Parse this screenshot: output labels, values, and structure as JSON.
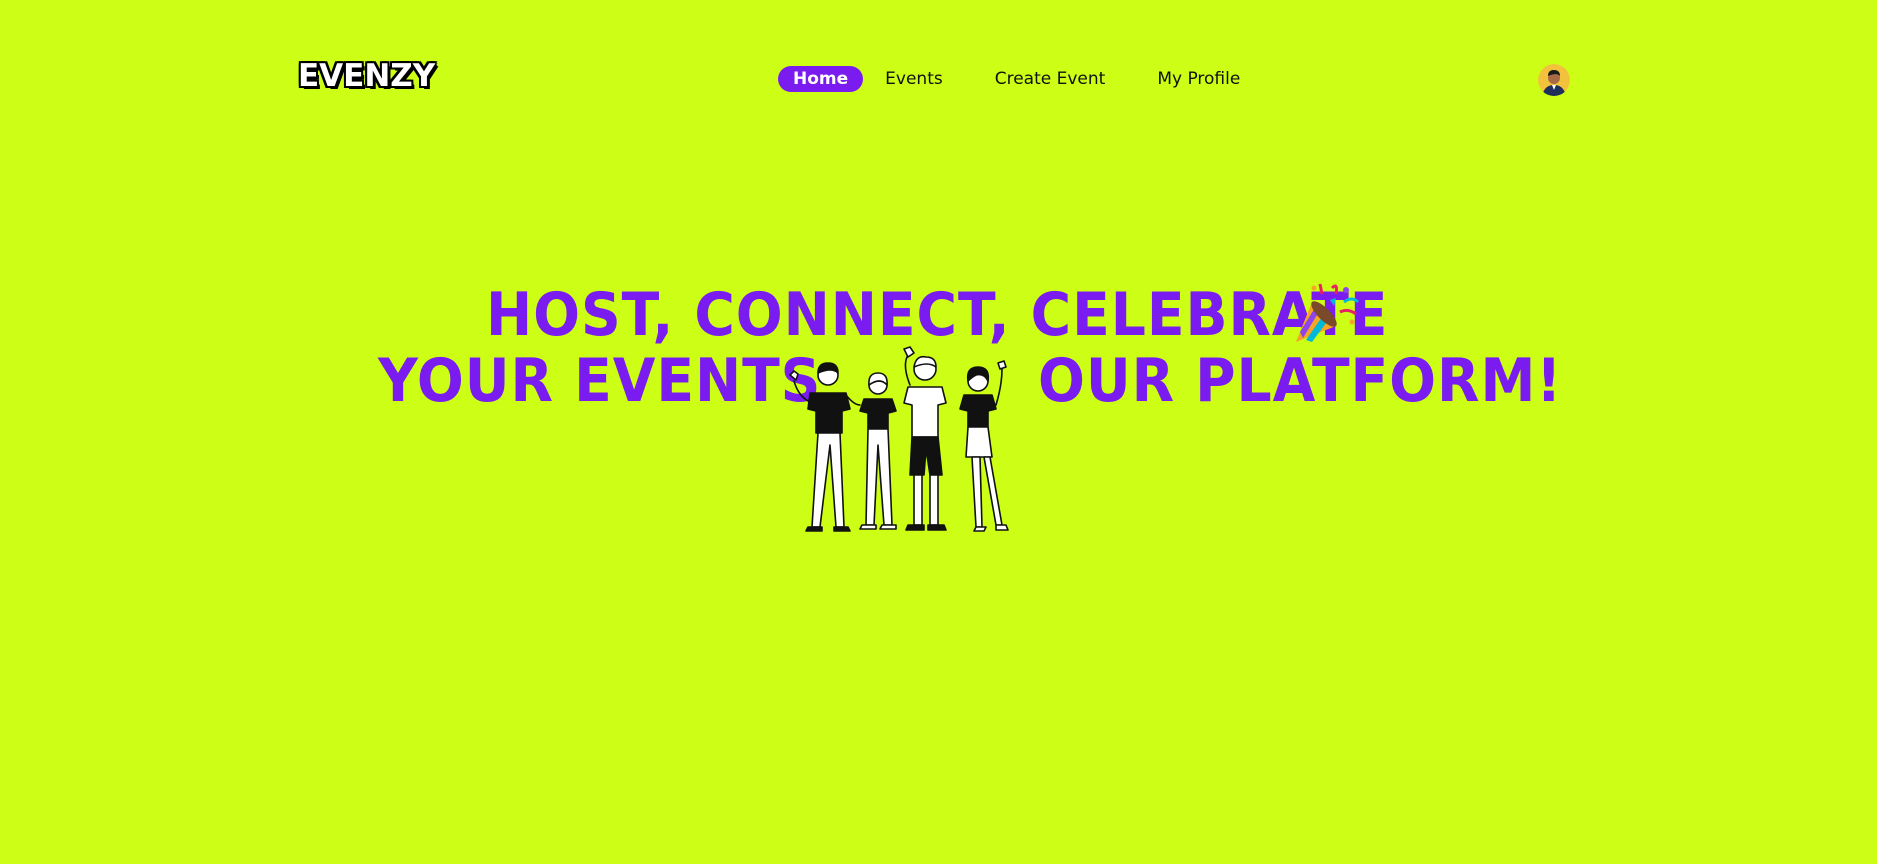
{
  "colors": {
    "background": "#ccff15",
    "accent": "#7a1cf0",
    "text": "#111111",
    "logo_fill": "#ffffff",
    "logo_stroke": "#000000"
  },
  "header": {
    "logo": "EVENZY",
    "nav": [
      {
        "label": "Home",
        "active": true
      },
      {
        "label": "Events",
        "active": false
      },
      {
        "label": "Create Event",
        "active": false
      },
      {
        "label": "My Profile",
        "active": false
      }
    ],
    "avatar_icon": "user-avatar-icon"
  },
  "hero": {
    "line1": "HOST, CONNECT, CELEBRATE",
    "line2_left": "YOUR EVENTS",
    "line2_right": "OUR PLATFORM!",
    "party_icon": "party-popper-icon",
    "illustration": "people-celebrating-illustration"
  }
}
